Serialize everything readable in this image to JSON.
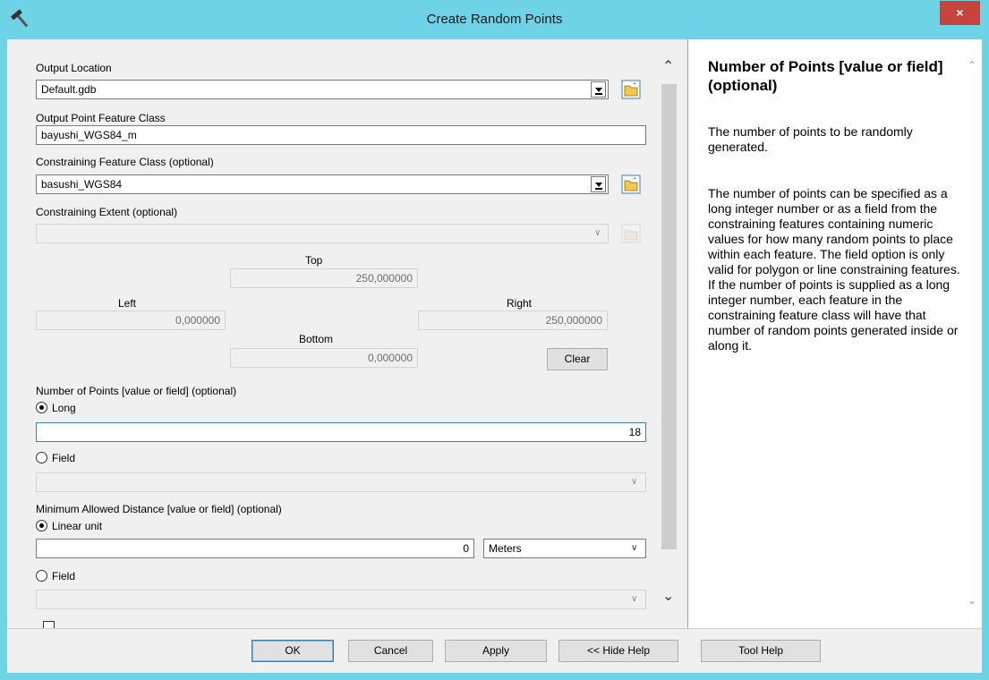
{
  "window": {
    "title": "Create Random Points",
    "close_glyph": "×",
    "app_icon": "hammer-icon"
  },
  "form": {
    "output_location": {
      "label": "Output Location",
      "value": "Default.gdb"
    },
    "output_feature_class": {
      "label": "Output Point Feature Class",
      "value": "bayushi_WGS84_m"
    },
    "constraining_feature_class": {
      "label": "Constraining Feature Class (optional)",
      "value": "basushi_WGS84"
    },
    "constraining_extent": {
      "label": "Constraining Extent (optional)",
      "value": "",
      "top_label": "Top",
      "top_value": "250,000000",
      "left_label": "Left",
      "left_value": "0,000000",
      "right_label": "Right",
      "right_value": "250,000000",
      "bottom_label": "Bottom",
      "bottom_value": "0,000000",
      "clear_label": "Clear"
    },
    "number_of_points": {
      "label": "Number of Points [value or field] (optional)",
      "long_label": "Long",
      "long_value": "18",
      "field_label": "Field",
      "field_value": ""
    },
    "min_distance": {
      "label": "Minimum Allowed Distance [value or field] (optional)",
      "linear_label": "Linear unit",
      "linear_value": "0",
      "unit_value": "Meters",
      "field_label": "Field",
      "field_value": ""
    }
  },
  "help": {
    "title": "Number of Points [value or field] (optional)",
    "para1": "The number of points to be randomly generated.",
    "para2": "The number of points can be specified as a long integer number or as a field from the constraining features containing numeric values for how many random points to place within each feature. The field option is only valid for polygon or line constraining features. If the number of points is supplied as a long integer number, each feature in the constraining feature class will have that number of random points generated inside or along it."
  },
  "buttons": {
    "ok": "OK",
    "cancel": "Cancel",
    "apply": "Apply",
    "hide_help": "<< Hide Help",
    "tool_help": "Tool Help"
  },
  "colors": {
    "titlebar": "#6fd3e8",
    "close": "#c7443c",
    "panel": "#f0f0f0",
    "default_button_border": "#3c7fb1"
  }
}
